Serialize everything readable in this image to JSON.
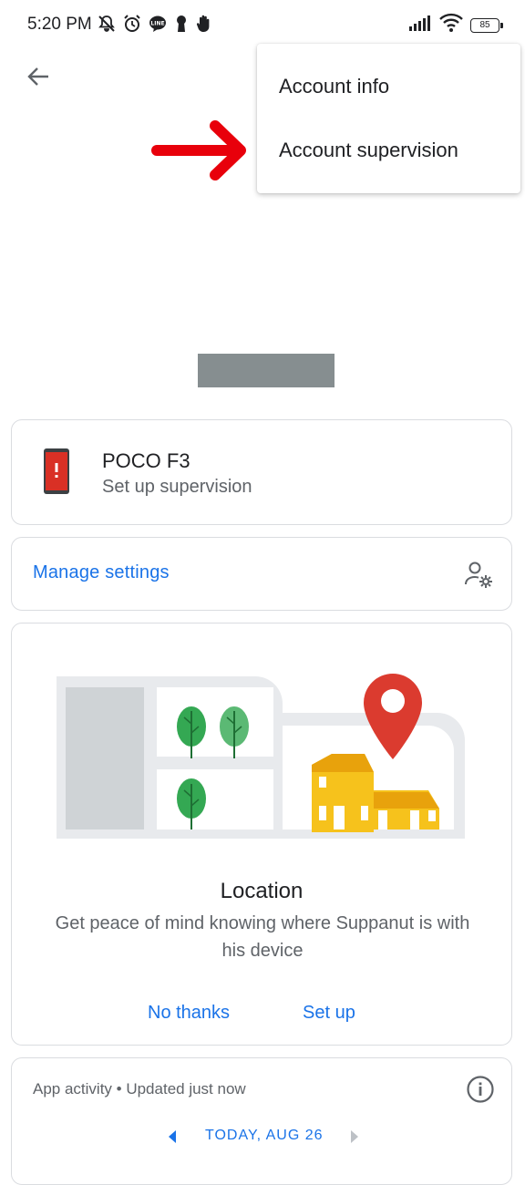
{
  "status_bar": {
    "time": "5:20 PM",
    "battery": "85",
    "left_icons": [
      "mute-bell-icon",
      "alarm-icon",
      "line-app-icon",
      "keyhole-icon",
      "hand-icon"
    ],
    "right_icons": [
      "signal-icon",
      "wifi-icon",
      "battery-icon"
    ]
  },
  "menu": {
    "items": [
      {
        "label": "Account info"
      },
      {
        "label": "Account supervision"
      }
    ]
  },
  "device_card": {
    "name": "POCO F3",
    "subtitle": "Set up supervision"
  },
  "manage_card": {
    "label": "Manage settings"
  },
  "location_card": {
    "title": "Location",
    "description": "Get peace of mind knowing where Suppanut is with his device",
    "no_thanks": "No thanks",
    "set_up": "Set up"
  },
  "activity_card": {
    "label": "App activity • Updated just now",
    "date": "TODAY, AUG 26"
  },
  "colors": {
    "accent": "#1a73e8",
    "arrow": "#e8000b",
    "pin": "#db3b2f",
    "tree": "#34a853",
    "house": "#f6c21c"
  }
}
